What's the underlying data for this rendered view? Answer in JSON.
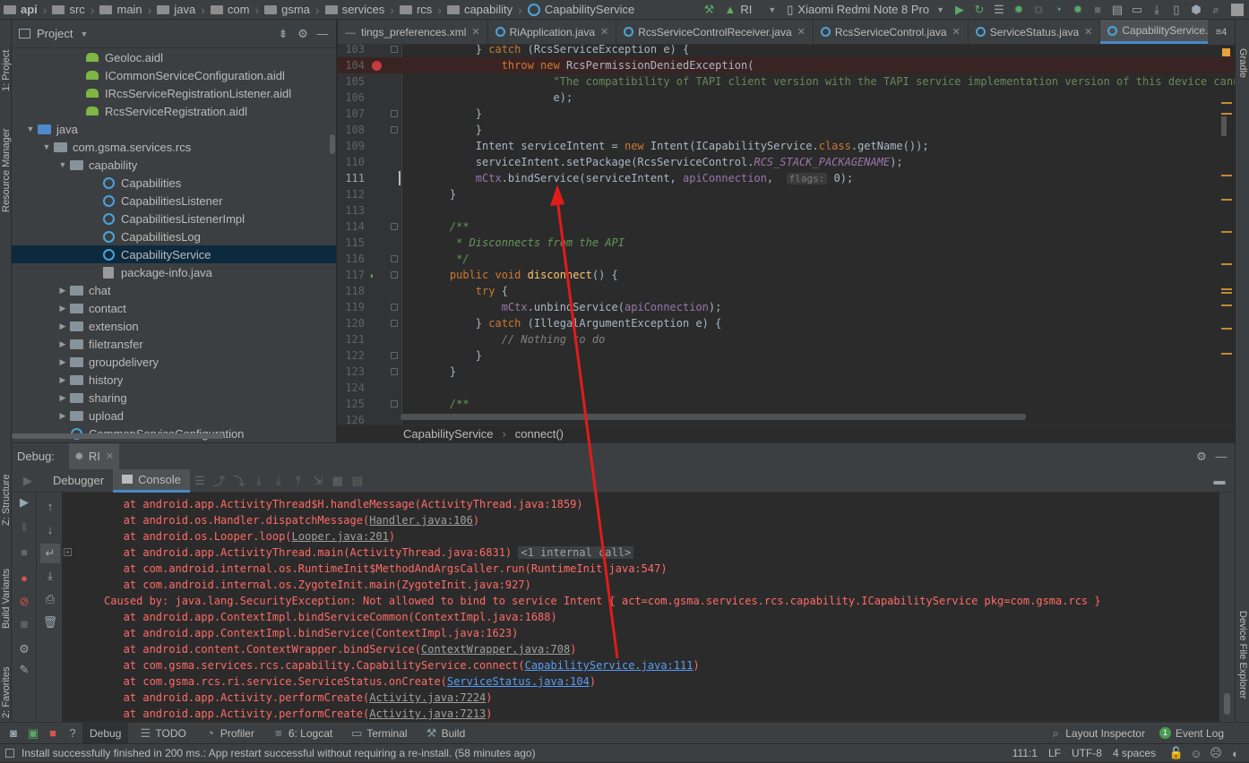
{
  "nav": {
    "crumbs": [
      "api",
      "src",
      "main",
      "java",
      "com",
      "gsma",
      "services",
      "rcs",
      "capability",
      "CapabilityService"
    ],
    "run_config": "RI",
    "device": "Xiaomi Redmi Note 8 Pro"
  },
  "sidestrip": {
    "left_top": [
      "1: Project",
      "Resource Manager"
    ],
    "left_bottom": [
      "Z: Structure",
      "Build Variants",
      "2: Favorites"
    ],
    "right": [
      "Gradle",
      "Device File Explorer"
    ]
  },
  "project": {
    "title": "Project",
    "items": [
      {
        "label": "Geoloc.aidl",
        "icon": "android",
        "indent": 6,
        "arrow": ""
      },
      {
        "label": "ICommonServiceConfiguration.aidl",
        "icon": "android",
        "indent": 6,
        "arrow": ""
      },
      {
        "label": "IRcsServiceRegistrationListener.aidl",
        "icon": "android",
        "indent": 6,
        "arrow": ""
      },
      {
        "label": "RcsServiceRegistration.aidl",
        "icon": "android",
        "indent": 6,
        "arrow": ""
      },
      {
        "label": "java",
        "icon": "folder-blue",
        "indent": 3,
        "arrow": "▼"
      },
      {
        "label": "com.gsma.services.rcs",
        "icon": "folder",
        "indent": 4,
        "arrow": "▼"
      },
      {
        "label": "capability",
        "icon": "folder",
        "indent": 5,
        "arrow": "▼"
      },
      {
        "label": "Capabilities",
        "icon": "class",
        "indent": 7,
        "arrow": ""
      },
      {
        "label": "CapabilitiesListener",
        "icon": "class",
        "indent": 7,
        "arrow": ""
      },
      {
        "label": "CapabilitiesListenerImpl",
        "icon": "class",
        "indent": 7,
        "arrow": ""
      },
      {
        "label": "CapabilitiesLog",
        "icon": "class",
        "indent": 7,
        "arrow": ""
      },
      {
        "label": "CapabilityService",
        "icon": "class",
        "indent": 7,
        "arrow": "",
        "selected": true
      },
      {
        "label": "package-info.java",
        "icon": "package",
        "indent": 7,
        "arrow": ""
      },
      {
        "label": "chat",
        "icon": "folder",
        "indent": 5,
        "arrow": "▶"
      },
      {
        "label": "contact",
        "icon": "folder",
        "indent": 5,
        "arrow": "▶"
      },
      {
        "label": "extension",
        "icon": "folder",
        "indent": 5,
        "arrow": "▶"
      },
      {
        "label": "filetransfer",
        "icon": "folder",
        "indent": 5,
        "arrow": "▶"
      },
      {
        "label": "groupdelivery",
        "icon": "folder",
        "indent": 5,
        "arrow": "▶"
      },
      {
        "label": "history",
        "icon": "folder",
        "indent": 5,
        "arrow": "▶"
      },
      {
        "label": "sharing",
        "icon": "folder",
        "indent": 5,
        "arrow": "▶"
      },
      {
        "label": "upload",
        "icon": "folder",
        "indent": 5,
        "arrow": "▶"
      },
      {
        "label": "CommonServiceConfiguration",
        "icon": "class",
        "indent": 5,
        "arrow": ""
      }
    ]
  },
  "tabs": [
    {
      "label": "tings_preferences.xml",
      "icon": false
    },
    {
      "label": "RiApplication.java",
      "icon": true
    },
    {
      "label": "RcsServiceControlReceiver.java",
      "icon": true
    },
    {
      "label": "RcsServiceControl.java",
      "icon": true
    },
    {
      "label": "ServiceStatus.java",
      "icon": true
    },
    {
      "label": "CapabilityService.java",
      "icon": true,
      "active": true
    }
  ],
  "tabs_overflow": "4",
  "editor": {
    "lines": [
      {
        "n": "103",
        "html": "        } <span class='kw'>catch</span> (RcsServiceException e) {"
      },
      {
        "n": "104",
        "html": "            <span class='kw'>throw new</span> RcsPermissionDeniedException(",
        "bp": true
      },
      {
        "n": "105",
        "html": "                    <span class='str'>\"The compatibility of TAPI client version with the TAPI service implementation version of this device cannot</span>"
      },
      {
        "n": "106",
        "html": "                    e);"
      },
      {
        "n": "107",
        "html": "        }"
      },
      {
        "n": "108",
        "html": "        }"
      },
      {
        "n": "109",
        "html": "        Intent serviceIntent = <span class='kw'>new</span> Intent(ICapabilityService.<span class='kw'>class</span>.getName());"
      },
      {
        "n": "110",
        "html": "        serviceIntent.setPackage(RcsServiceControl.<span class='cst'>RCS_STACK_PACKAGENAME</span>);"
      },
      {
        "n": "111",
        "html": "        <span class='fld'>mCtx</span>.bindService(serviceIntent, <span class='fld'>apiConnection</span>,  <span class='hint'>flags:</span> 0);",
        "cur": true
      },
      {
        "n": "112",
        "html": "    }"
      },
      {
        "n": "113",
        "html": ""
      },
      {
        "n": "114",
        "html": "    <span class='cm'>/**</span>"
      },
      {
        "n": "115",
        "html": "    <span class='cm'> * Disconnects from the API</span>"
      },
      {
        "n": "116",
        "html": "    <span class='cm'> */</span>"
      },
      {
        "n": "117",
        "html": "    <span class='kw'>public void</span> <span class='fn'>disconnect</span>() {"
      },
      {
        "n": "118",
        "html": "        <span class='kw'>try</span> {"
      },
      {
        "n": "119",
        "html": "            <span class='fld'>mCtx</span>.unbindService(<span class='fld'>apiConnection</span>);"
      },
      {
        "n": "120",
        "html": "        } <span class='kw'>catch</span> (IllegalArgumentException e) {"
      },
      {
        "n": "121",
        "html": "            <span class='cm' style='color:#808080'>// Nothing to do</span>"
      },
      {
        "n": "122",
        "html": "        }"
      },
      {
        "n": "123",
        "html": "    }"
      },
      {
        "n": "124",
        "html": ""
      },
      {
        "n": "125",
        "html": "    <span class='cm'>/**</span>"
      },
      {
        "n": "126",
        "html": ""
      }
    ]
  },
  "editor_breadcrumb": [
    "CapabilityService",
    "connect()"
  ],
  "debug": {
    "title": "Debug:",
    "config": "RI",
    "tabs": [
      "Debugger",
      "Console"
    ]
  },
  "console": [
    {
      "indent": "    ",
      "html": "at android.app.ActivityThread$H.handleMessage(ActivityThread.java:1859)"
    },
    {
      "indent": "    ",
      "html": "at android.os.Handler.dispatchMessage(<span class='lnk'>Handler.java:106</span>)"
    },
    {
      "indent": "    ",
      "html": "at android.os.Looper.loop(<span class='lnk'>Looper.java:201</span>)"
    },
    {
      "indent": "    ",
      "html": "at android.app.ActivityThread.main(ActivityThread.java:6831) <span class='badge'>&lt;1 internal call&gt;</span>"
    },
    {
      "indent": "    ",
      "html": "at com.android.internal.os.RuntimeInit$MethodAndArgsCaller.run(RuntimeInit.java:547)"
    },
    {
      "indent": "    ",
      "html": "at com.android.internal.os.ZygoteInit.main(ZygoteInit.java:927)"
    },
    {
      "indent": "",
      "html": "Caused by: java.lang.SecurityException: Not allowed to bind to service Intent { act=com.gsma.services.rcs.capability.ICapabilityService pkg=com.gsma.rcs }"
    },
    {
      "indent": "    ",
      "html": "at android.app.ContextImpl.bindServiceCommon(ContextImpl.java:1688)"
    },
    {
      "indent": "    ",
      "html": "at android.app.ContextImpl.bindService(ContextImpl.java:1623)"
    },
    {
      "indent": "    ",
      "html": "at android.content.ContextWrapper.bindService(<span class='lnk'>ContextWrapper.java:708</span>)"
    },
    {
      "indent": "    ",
      "html": "at com.gsma.services.rcs.capability.CapabilityService.connect(<span class='lnkb'>CapabilityService.java:111</span>)"
    },
    {
      "indent": "    ",
      "html": "at com.gsma.rcs.ri.service.ServiceStatus.onCreate(<span class='lnkb'>ServiceStatus.java:104</span>)"
    },
    {
      "indent": "    ",
      "html": "at android.app.Activity.performCreate(<span class='lnk'>Activity.java:7224</span>)"
    },
    {
      "indent": "    ",
      "html": "at android.app.Activity.performCreate(<span class='lnk'>Activity.java:7213</span>)"
    }
  ],
  "bottom_tabs": [
    "Debug",
    "TODO",
    "Profiler",
    "6: Logcat",
    "Terminal",
    "Build"
  ],
  "bottom_right": [
    "Layout Inspector",
    "Event Log"
  ],
  "event_count": "1",
  "status": {
    "message": "Install successfully finished in 200 ms.: App restart successful without requiring a re-install. (58 minutes ago)",
    "position": "111:1",
    "line_sep": "LF",
    "encoding": "UTF-8",
    "indent": "4 spaces"
  }
}
